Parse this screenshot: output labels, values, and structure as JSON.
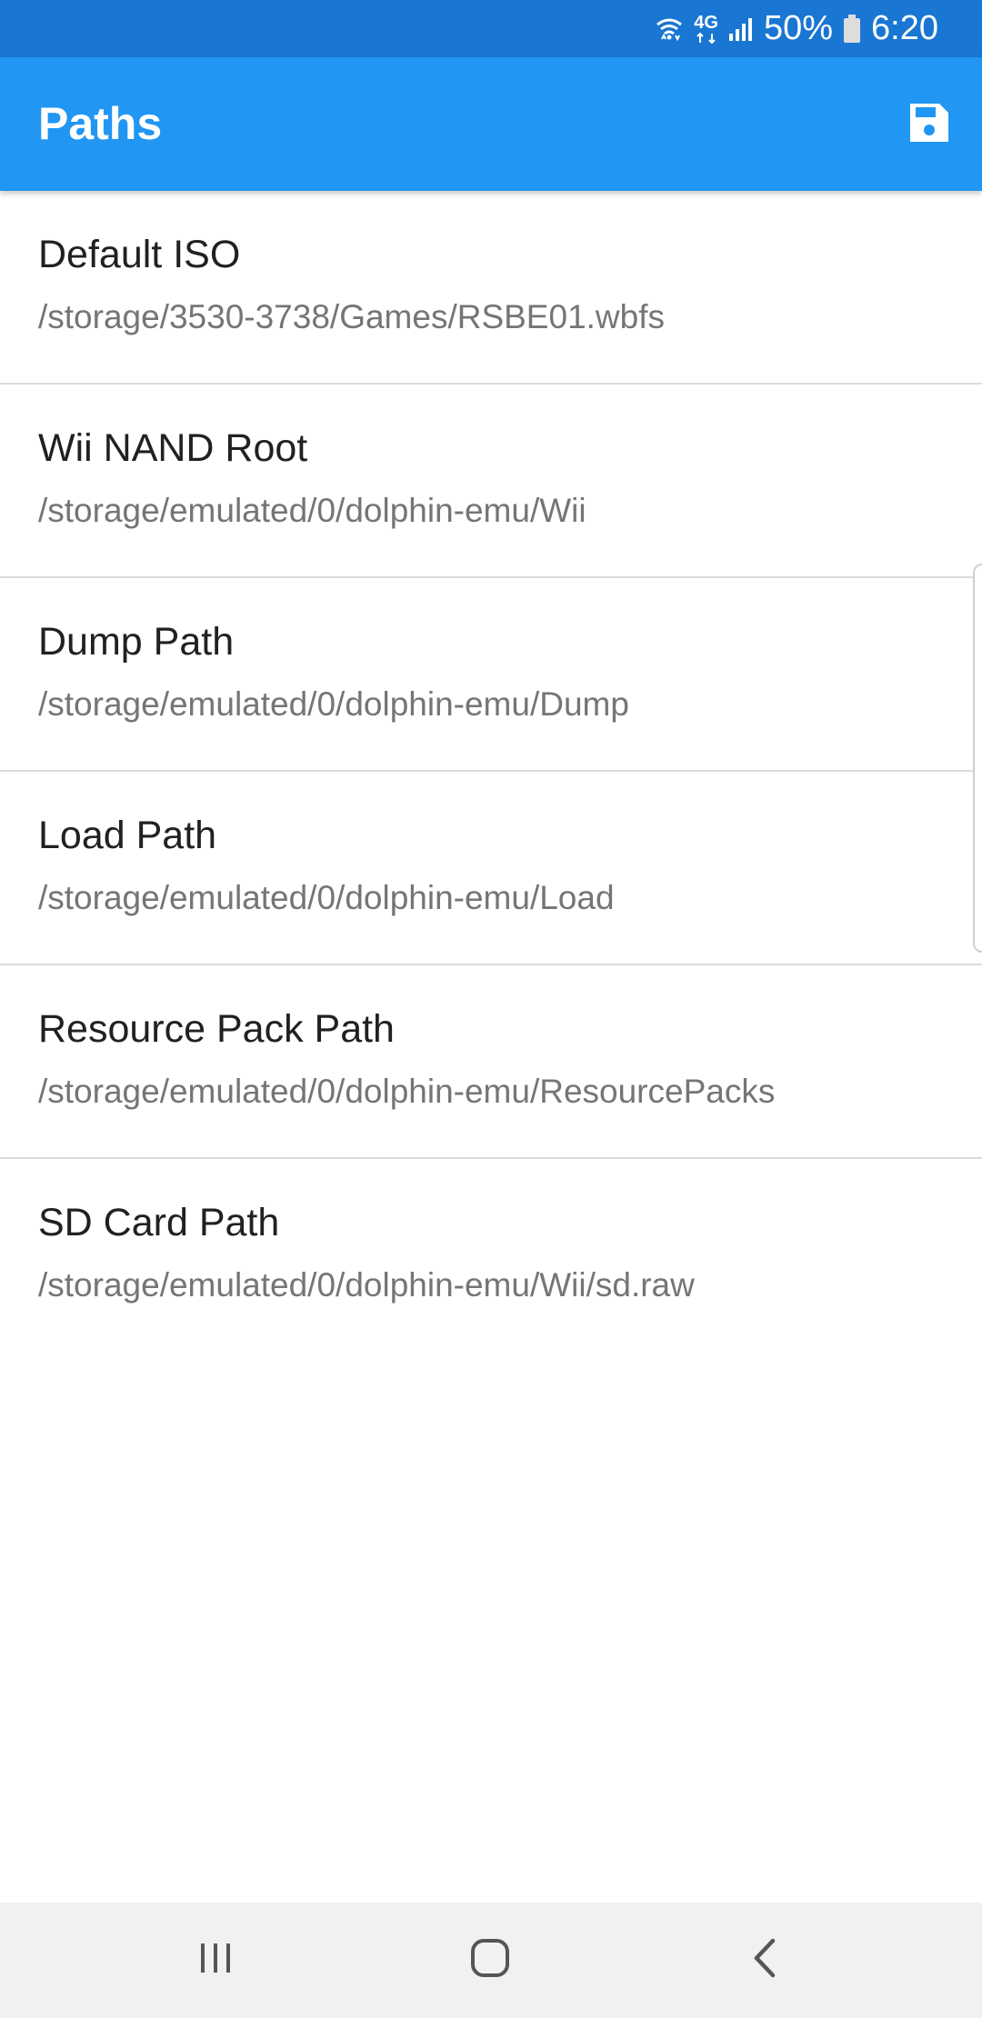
{
  "status_bar": {
    "network": "4G",
    "battery": "50%",
    "time": "6:20"
  },
  "toolbar": {
    "title": "Paths",
    "save_icon": "floppy-disk-save-icon"
  },
  "paths": [
    {
      "title": "Default ISO",
      "value": "/storage/3530-3738/Games/RSBE01.wbfs"
    },
    {
      "title": "Wii NAND Root",
      "value": "/storage/emulated/0/dolphin-emu/Wii"
    },
    {
      "title": "Dump Path",
      "value": "/storage/emulated/0/dolphin-emu/Dump"
    },
    {
      "title": "Load Path",
      "value": "/storage/emulated/0/dolphin-emu/Load"
    },
    {
      "title": "Resource Pack Path",
      "value": "/storage/emulated/0/dolphin-emu/ResourcePacks"
    },
    {
      "title": "SD Card Path",
      "value": "/storage/emulated/0/dolphin-emu/Wii/sd.raw"
    }
  ],
  "nav_bar": {
    "recents_icon": "recents-icon",
    "home_icon": "home-icon",
    "back_icon": "back-icon"
  },
  "colors": {
    "status_bar": "#1976d2",
    "toolbar": "#2196f3",
    "title_text": "#212121",
    "subtitle_text": "#757575",
    "divider": "#dcdcdc",
    "nav_bar": "#f1f1f1"
  }
}
